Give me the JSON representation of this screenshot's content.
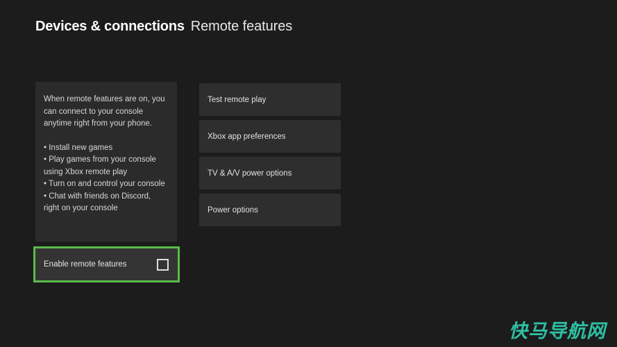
{
  "header": {
    "section": "Devices & connections",
    "page": "Remote features"
  },
  "description": {
    "intro": "When remote features are on, you can connect to your console anytime right from your phone.",
    "bullets": [
      "Install new games",
      "Play games from your console using Xbox remote play",
      "Turn on and control your console",
      "Chat with friends on Discord, right on your console"
    ]
  },
  "toggle": {
    "label": "Enable remote features",
    "checked": false,
    "focus_color": "#5abb4a"
  },
  "menu": {
    "items": [
      {
        "label": "Test remote play"
      },
      {
        "label": "Xbox app preferences"
      },
      {
        "label": "TV & A/V power options"
      },
      {
        "label": "Power options"
      }
    ]
  },
  "watermark": {
    "text": "快马导航网",
    "color": "#2ebfa3"
  },
  "theme": {
    "background": "#1c1c1c",
    "panel": "#2b2b2b",
    "menu_item": "#2e2e2e",
    "text_primary": "#ffffff",
    "text_secondary": "#d8d8d8"
  }
}
